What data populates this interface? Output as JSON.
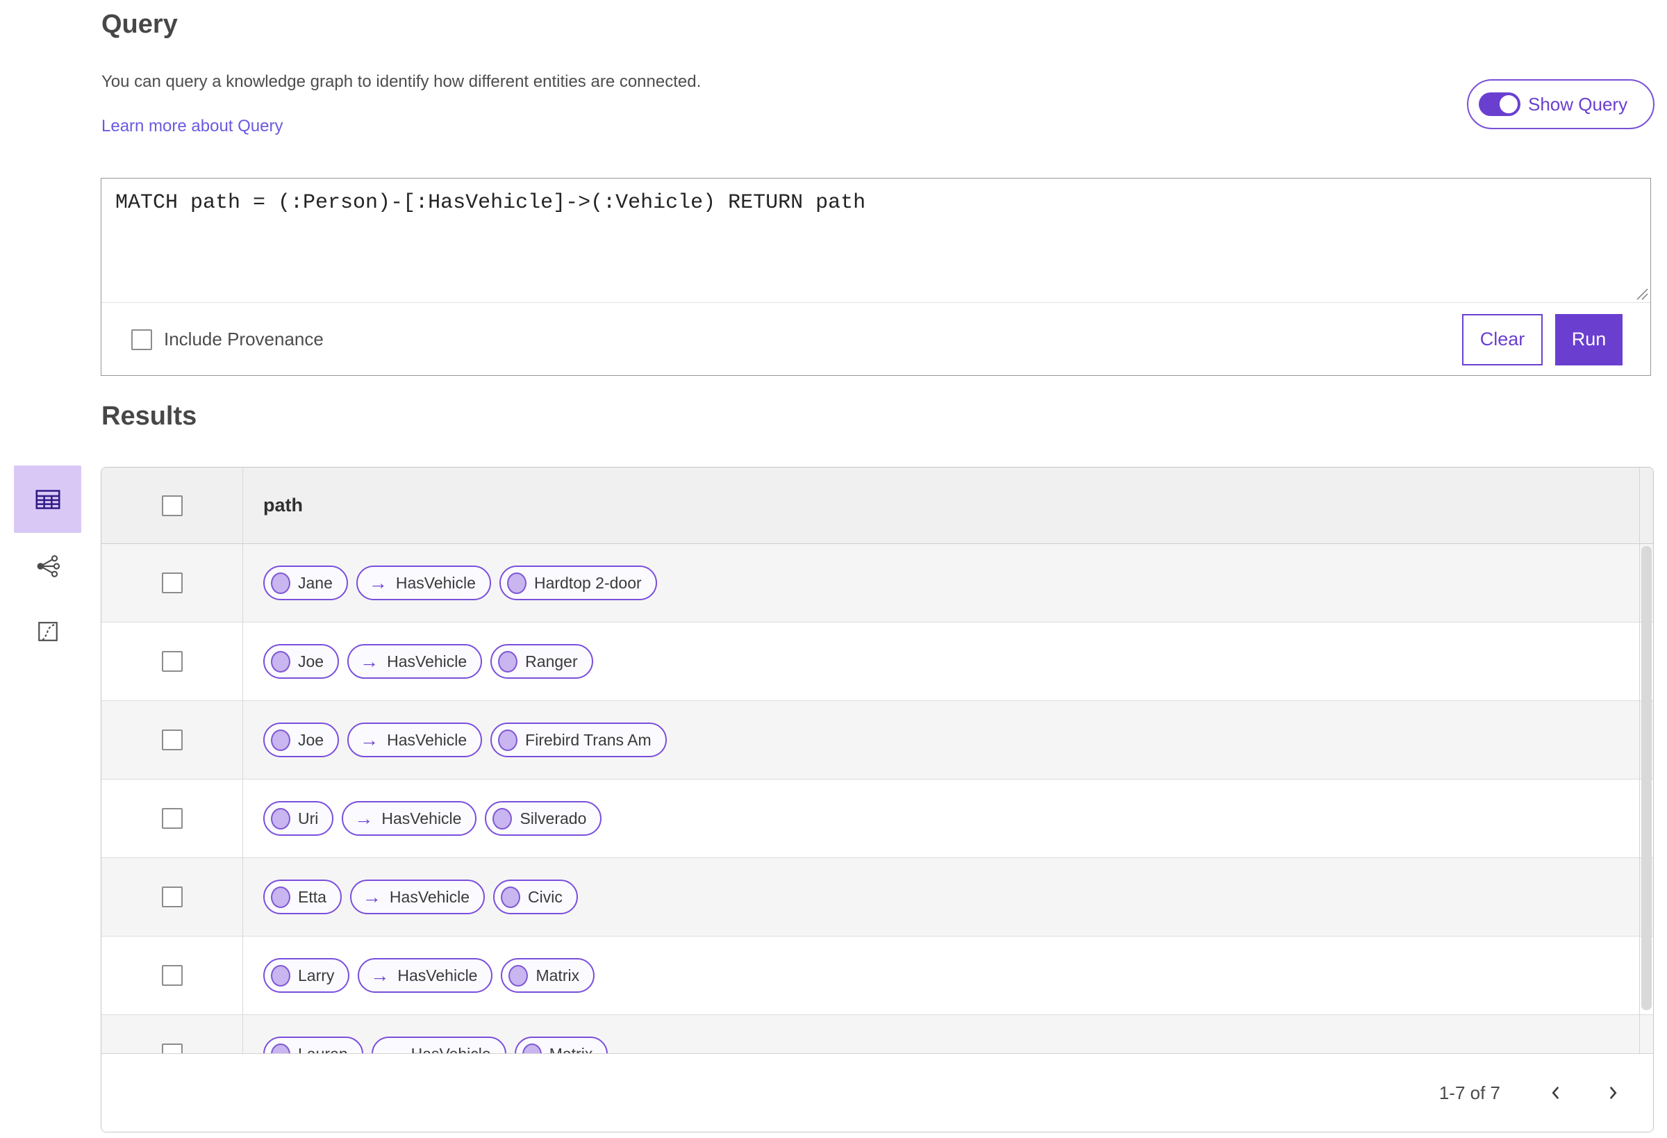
{
  "query_panel": {
    "title": "Query",
    "description": "You can query a knowledge graph to identify how different entities are connected.",
    "learn_more_link": "Learn more about Query",
    "show_query_toggle": {
      "label": "Show Query",
      "enabled": true
    },
    "editor": {
      "query_text": "MATCH path = (:Person)-[:HasVehicle]->(:Vehicle) RETURN path"
    },
    "include_provenance": {
      "label": "Include Provenance",
      "checked": false
    },
    "buttons": {
      "clear": "Clear",
      "run": "Run"
    }
  },
  "results_panel": {
    "title": "Results",
    "view_switcher": [
      {
        "name": "table-view",
        "selected": true
      },
      {
        "name": "link-chart-view",
        "selected": false
      },
      {
        "name": "map-view",
        "selected": false
      }
    ],
    "table": {
      "column_header": "path",
      "rows": [
        {
          "source": "Jane",
          "relationship": "HasVehicle",
          "target": "Hardtop 2-door"
        },
        {
          "source": "Joe",
          "relationship": "HasVehicle",
          "target": "Ranger"
        },
        {
          "source": "Joe",
          "relationship": "HasVehicle",
          "target": "Firebird Trans Am"
        },
        {
          "source": "Uri",
          "relationship": "HasVehicle",
          "target": "Silverado"
        },
        {
          "source": "Etta",
          "relationship": "HasVehicle",
          "target": "Civic"
        },
        {
          "source": "Larry",
          "relationship": "HasVehicle",
          "target": "Matrix"
        },
        {
          "source": "Lauren",
          "relationship": "HasVehicle",
          "target": "Matrix"
        }
      ]
    },
    "pagination": {
      "range_label": "1-7 of 7"
    }
  },
  "icons": {
    "arrow_right": "→"
  },
  "colors": {
    "accent": "#6a3fd0",
    "pill_border": "#7a4fdc",
    "node_fill": "#c9b5ef",
    "selected_view_bg": "#d9c8f6",
    "link": "#6a5ae0",
    "header_row_bg": "#f1f0f0",
    "alt_row_bg": "#f6f5f5"
  }
}
